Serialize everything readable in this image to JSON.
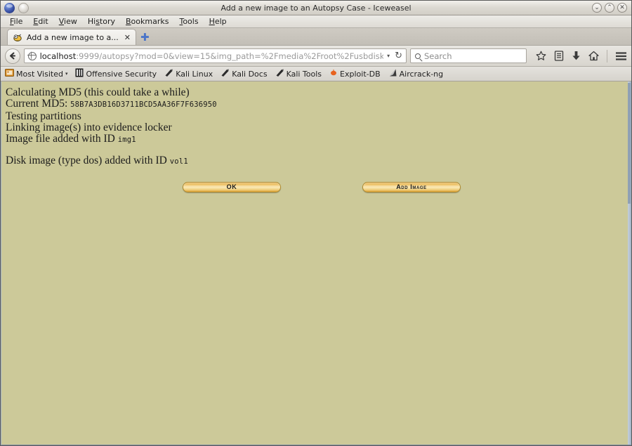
{
  "window": {
    "title": "Add a new image to an Autopsy Case - Iceweasel",
    "controls": [
      {
        "name": "minimize",
        "glyph": "⌄"
      },
      {
        "name": "maximize",
        "glyph": "⌃"
      },
      {
        "name": "close",
        "glyph": "✕"
      }
    ]
  },
  "menubar": {
    "items": [
      {
        "label": "File",
        "accesskey": "F"
      },
      {
        "label": "Edit",
        "accesskey": "E"
      },
      {
        "label": "View",
        "accesskey": "V"
      },
      {
        "label": "History",
        "accesskey": "s"
      },
      {
        "label": "Bookmarks",
        "accesskey": "B"
      },
      {
        "label": "Tools",
        "accesskey": "T"
      },
      {
        "label": "Help",
        "accesskey": "H"
      }
    ]
  },
  "tabs": {
    "active": {
      "label": "Add a new image to a...",
      "close_glyph": "✕",
      "favicon": "autopsy-icon"
    },
    "new_tab_glyph": "✚"
  },
  "navbar": {
    "back_glyph": "←",
    "url_host": "localhost",
    "url_rest": ":9999/autopsy?mod=0&view=15&img_path=%2Fmedia%2Froot%2Fusbdisk♦",
    "url_full": "localhost:9999/autopsy?mod=0&view=15&img_path=%2Fmedia%2Froot%2Fusbdisk",
    "dropdown_glyph": "▾",
    "reload_glyph": "↻",
    "search_placeholder": "Search",
    "icons": [
      {
        "name": "bookmark-star-icon",
        "glyph": "☆"
      },
      {
        "name": "library-icon",
        "glyph": "⌸"
      },
      {
        "name": "downloads-icon",
        "glyph": "⬇"
      },
      {
        "name": "home-icon",
        "glyph": "⌂"
      },
      {
        "name": "menu-icon",
        "glyph": "☰"
      }
    ]
  },
  "bookmarks": {
    "items": [
      {
        "label": "Most Visited",
        "icon": "most-visited-icon",
        "caret": "▾"
      },
      {
        "label": "Offensive Security",
        "icon": "offensive-security-icon"
      },
      {
        "label": "Kali Linux",
        "icon": "kali-dragon-icon"
      },
      {
        "label": "Kali Docs",
        "icon": "kali-dragon-icon"
      },
      {
        "label": "Kali Tools",
        "icon": "kali-dragon-icon"
      },
      {
        "label": "Exploit-DB",
        "icon": "exploit-db-icon"
      },
      {
        "label": "Aircrack-ng",
        "icon": "aircrack-ng-icon"
      }
    ]
  },
  "page": {
    "background_color": "#ccc999",
    "lines": [
      {
        "text": "Calculating MD5 (this could take a while)"
      },
      {
        "text": "Current MD5: ",
        "mono": "58B7A3DB16D3711BCD5AA36F7F636950"
      },
      {
        "text": "Testing partitions"
      },
      {
        "text": "Linking image(s) into evidence locker"
      },
      {
        "text": "Image file added with ID ",
        "mono": "img1"
      }
    ],
    "result_line": {
      "text": "Disk image (type dos) added with ID ",
      "mono": "vol1"
    },
    "buttons": [
      {
        "id": "ok",
        "label": "OK"
      },
      {
        "id": "add-image",
        "label": "Add Image"
      }
    ],
    "button_color": "#edc166"
  }
}
